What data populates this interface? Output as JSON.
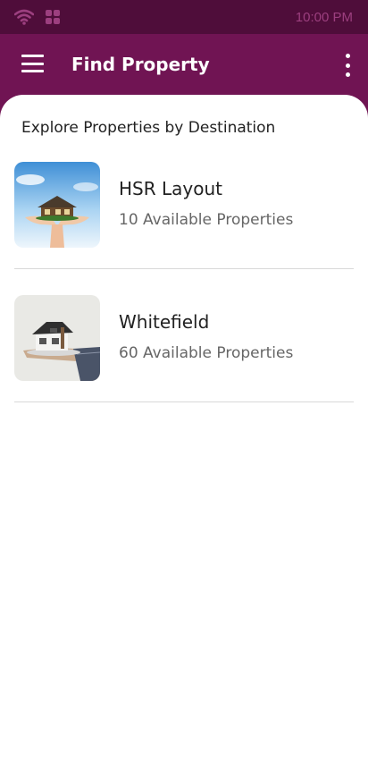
{
  "status_bar": {
    "time": "10:00 PM",
    "icons": [
      "wifi-icon",
      "apps-grid-icon"
    ]
  },
  "app_bar": {
    "title": "Find Property",
    "menu_icon": "hamburger-menu-icon",
    "more_icon": "more-vertical-icon"
  },
  "section": {
    "title": "Explore Properties by Destination"
  },
  "destinations": [
    {
      "name": "HSR Layout",
      "count": "10 Available Properties",
      "image": "house-on-hands-sky-image"
    },
    {
      "name": "Whitefield",
      "count": "60 Available Properties",
      "image": "house-model-on-hand-image"
    }
  ],
  "colors": {
    "status_bar": "#4f0d3a",
    "app_bar": "#701453",
    "status_text": "#9c3f7f"
  }
}
